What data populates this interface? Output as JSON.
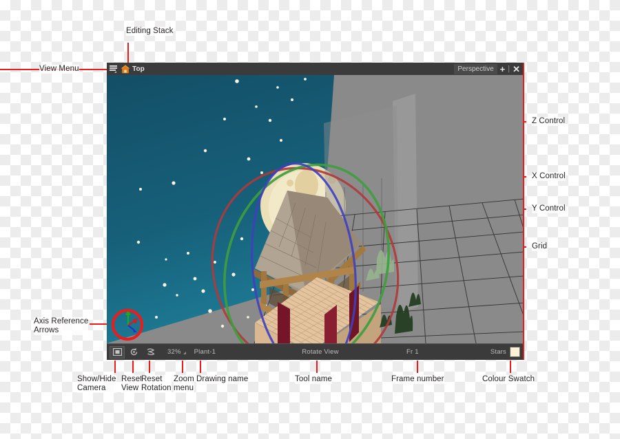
{
  "window": {
    "titlebar": {
      "view_menu_icon": "hamburger-menu-icon",
      "editing_stack_icon": "home-house-icon",
      "editing_stack_label": "Top",
      "view_type_label": "Perspective",
      "add_button_label": "+",
      "close_button_label": "✕"
    },
    "statusbar": {
      "show_hide_camera_icon": "camera-icon",
      "reset_view_icon": "reset-view-icon",
      "reset_rotation_icon": "reset-rotation-icon",
      "zoom_value": "32%",
      "zoom_menu_icon": "dropdown-caret-icon",
      "drawing_name": "Plant-1",
      "tool_name": "Rotate View",
      "frame_number": "Fr 1",
      "colour_name": "Stars",
      "colour_swatch_hex": "#faf2d4"
    },
    "viewport": {
      "axis_arrows_icon": "axis-reference-arrows-icon",
      "z_control_color": "#b03a3a",
      "x_control_color": "#3f9e3f",
      "y_control_color": "#4040c0",
      "sky_color": "#15556b",
      "background_color": "#8a8a8a",
      "moon_color": "#ece0b8"
    }
  },
  "annotations": {
    "editing_stack": "Editing Stack",
    "view_menu": "View Menu",
    "z_control": "Z Control",
    "x_control": "X Control",
    "y_control": "Y Control",
    "grid": "Grid",
    "axis_reference_arrows": "Axis Reference\nArrows",
    "show_hide_camera": "Show/Hide\nCamera",
    "reset_view": "Reset\nView",
    "reset_rotation": "Reset\nRotation",
    "zoom_menu": "Zoom\nmenu",
    "drawing_name": "Drawing name",
    "tool_name": "Tool name",
    "frame_number": "Frame number",
    "colour_swatch": "Colour Swatch"
  },
  "colors": {
    "leader_line": "#ee1b1b",
    "annotation_text": "#231f20",
    "chrome": "#3b3b3b"
  }
}
